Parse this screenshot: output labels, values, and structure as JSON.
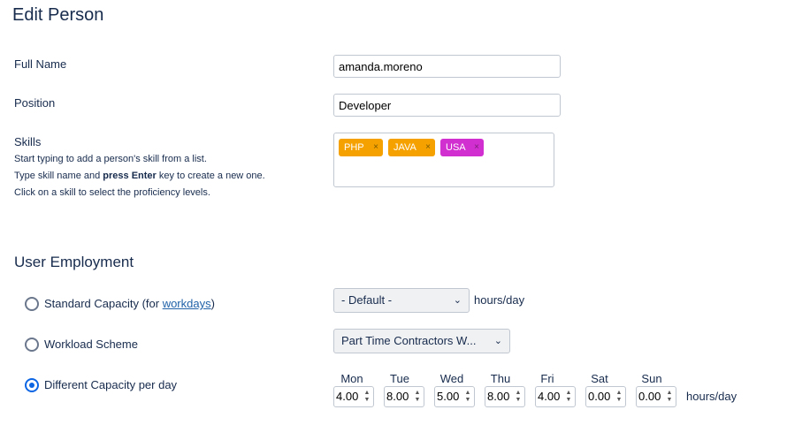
{
  "page": {
    "title": "Edit Person"
  },
  "form": {
    "full_name": {
      "label": "Full Name",
      "value": "amanda.moreno"
    },
    "position": {
      "label": "Position",
      "value": "Developer"
    },
    "skills": {
      "label": "Skills",
      "help_line1": "Start typing to add a person's skill from a list.",
      "help_line2_pre": "Type skill name and ",
      "help_line2_bold": "press Enter",
      "help_line2_post": " key to create a new one.",
      "help_line3": "Click on a skill to select the proficiency levels.",
      "tags": [
        {
          "label": "PHP",
          "color": "#f5a100"
        },
        {
          "label": "JAVA",
          "color": "#f5a100"
        },
        {
          "label": "USA",
          "color": "#d12fcf"
        }
      ],
      "remove_glyph": "×"
    }
  },
  "employment": {
    "title": "User Employment",
    "options": {
      "standard": {
        "label_pre": "Standard Capacity (for ",
        "link": "workdays",
        "label_post": ")",
        "checked": false
      },
      "workload": {
        "label": "Workload Scheme",
        "checked": false
      },
      "different": {
        "label": "Different Capacity per day",
        "checked": true
      }
    },
    "standard_select": {
      "value": "- Default -",
      "units": "hours/day"
    },
    "scheme_select": {
      "value": "Part Time Contractors W..."
    },
    "days": [
      {
        "label": "Mon",
        "value": "4.00"
      },
      {
        "label": "Tue",
        "value": "8.00"
      },
      {
        "label": "Wed",
        "value": "5.00"
      },
      {
        "label": "Thu",
        "value": "8.00"
      },
      {
        "label": "Fri",
        "value": "4.00"
      },
      {
        "label": "Sat",
        "value": "0.00"
      },
      {
        "label": "Sun",
        "value": "0.00"
      }
    ],
    "days_units": "hours/day"
  },
  "colors": {
    "accent": "#0c66e4",
    "link": "#2162a8",
    "tag_orange": "#f5a100",
    "tag_purple": "#d12fcf"
  },
  "icons": {
    "select": "chevron-down-icon",
    "spinner": "spinner-icon",
    "remove": "close-icon"
  }
}
